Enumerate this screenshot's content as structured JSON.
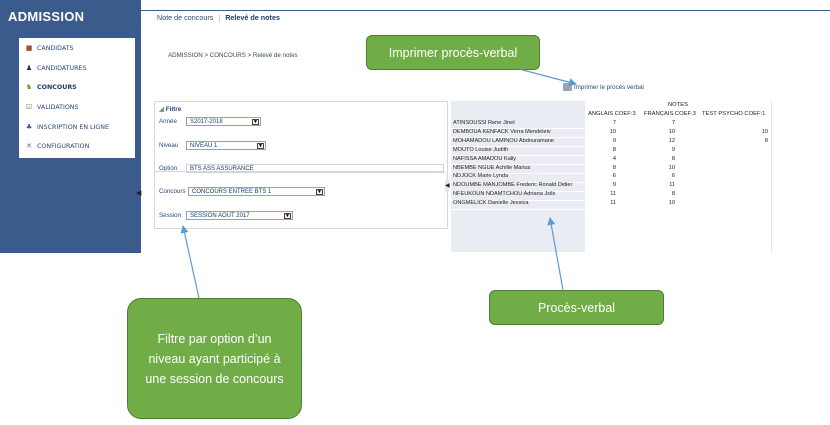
{
  "app": {
    "title": "ADMISSION"
  },
  "sidebar": {
    "items": [
      {
        "label": "CANDIDATS",
        "icon": "candidates-icon"
      },
      {
        "label": "CANDIDATURES",
        "icon": "applications-icon"
      },
      {
        "label": "CONCOURS",
        "icon": "exam-icon"
      },
      {
        "label": "VALIDATIONS",
        "icon": "validation-icon"
      },
      {
        "label": "INSCRIPTION EN LIGNE",
        "icon": "online-registration-icon"
      },
      {
        "label": "CONFIGURATION",
        "icon": "tools-icon"
      }
    ],
    "active": "CONCOURS"
  },
  "topnav": {
    "tab1": "Note de concours",
    "sep": "|",
    "tab2": "Relevé de notes"
  },
  "breadcrumb": "ADMISSION > CONCOURS > Relevé de notes",
  "print_link": "Imprimer le procès verbal",
  "filter": {
    "title": "Filtre",
    "annee_label": "Année",
    "annee_value": "S2017-2018",
    "niveau_label": "Niveau",
    "niveau_value": "NIVEAU 1",
    "option_label": "Option",
    "option_value": "BTS ASS ASSURANCE",
    "concours_label": "Concours",
    "concours_value": "CONCOURS ENTREE BTS 1",
    "session_label": "Session",
    "session_value": "SESSION AOUT 2017"
  },
  "grid": {
    "header": "NOTES",
    "columns": [
      "ANGLAIS COEF:3",
      "FRANÇAIS COEF:3",
      "TEST PSYCHO COEF:1"
    ],
    "rows": [
      {
        "name": "ATINSOUSSI Rene Jinet",
        "c1": "7",
        "c2": "7",
        "c3": ""
      },
      {
        "name": "DEMBOUA KENFACK Verra Mendeleiv",
        "c1": "10",
        "c2": "10",
        "c3": "10"
      },
      {
        "name": "MOHAMADOU LAMINOU Abdouramane",
        "c1": "9",
        "c2": "12",
        "c3": "8"
      },
      {
        "name": "MOUTO Louise Judith",
        "c1": "8",
        "c2": "9",
        "c3": ""
      },
      {
        "name": "NAFISSA AMADOU Kally",
        "c1": "4",
        "c2": "8",
        "c3": ""
      },
      {
        "name": "NBEMBE NGUE Achille Marius",
        "c1": "8",
        "c2": "10",
        "c3": ""
      },
      {
        "name": "NDJOCK Marie Lynda",
        "c1": "6",
        "c2": "6",
        "c3": ""
      },
      {
        "name": "NDOUMBE MANJOMBE Frederic Ronald Didier",
        "c1": "9",
        "c2": "11",
        "c3": ""
      },
      {
        "name": "NFEUKOUN NDAMTCHOU Adriana Jsils",
        "c1": "11",
        "c2": "8",
        "c3": ""
      },
      {
        "name": "ONGMELICK Danielle Jessica",
        "c1": "11",
        "c2": "10",
        "c3": ""
      }
    ]
  },
  "callouts": {
    "print": "Imprimer procès-verbal",
    "pv": "Procès-verbal",
    "filter": "Filtre par option d’un niveau ayant participé à une session de concours"
  },
  "colors": {
    "sidebar": "#3b5b8c",
    "callout": "#70ad47",
    "arrow": "#5b9bd5"
  }
}
